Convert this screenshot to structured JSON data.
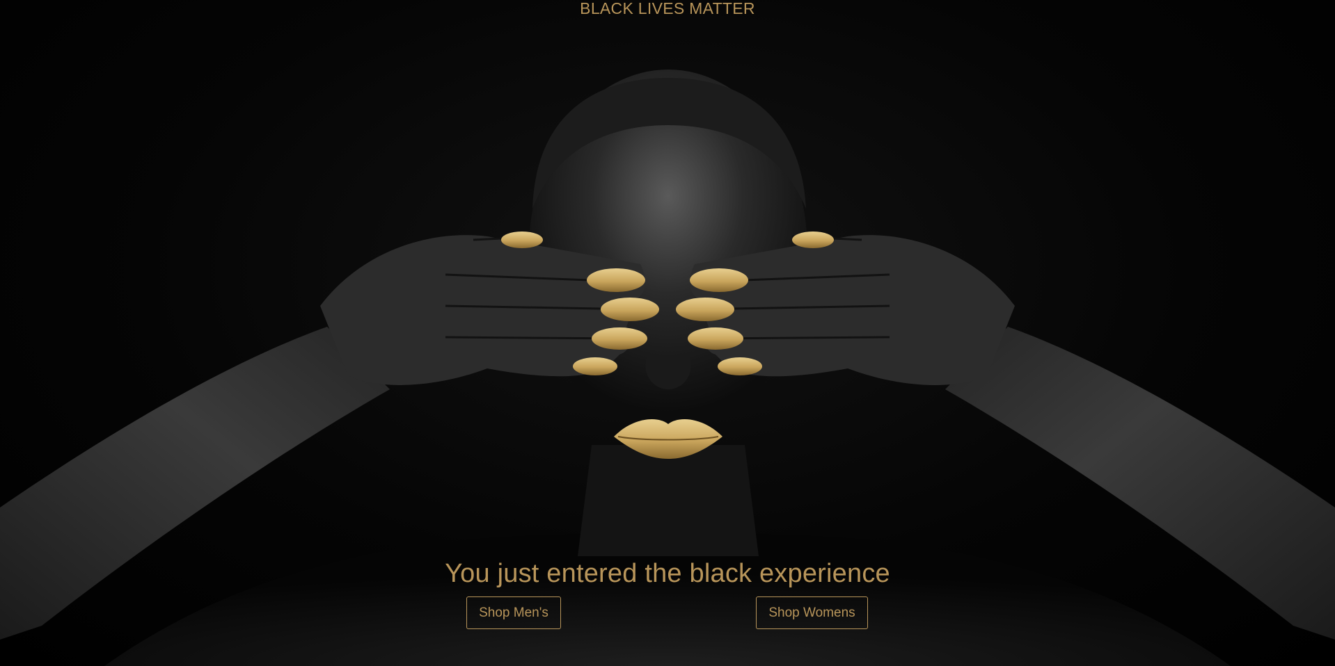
{
  "banner": {
    "text": "BLACK LIVES MATTER"
  },
  "hero": {
    "image_description": "photo-of-person-covering-eyes-with-hands",
    "headline": "You just entered the black experience"
  },
  "buttons": {
    "shop_mens": "Shop Men's",
    "shop_womens": "Shop Womens"
  },
  "colors": {
    "accent_gold": "#b8955a",
    "background": "#000000"
  }
}
